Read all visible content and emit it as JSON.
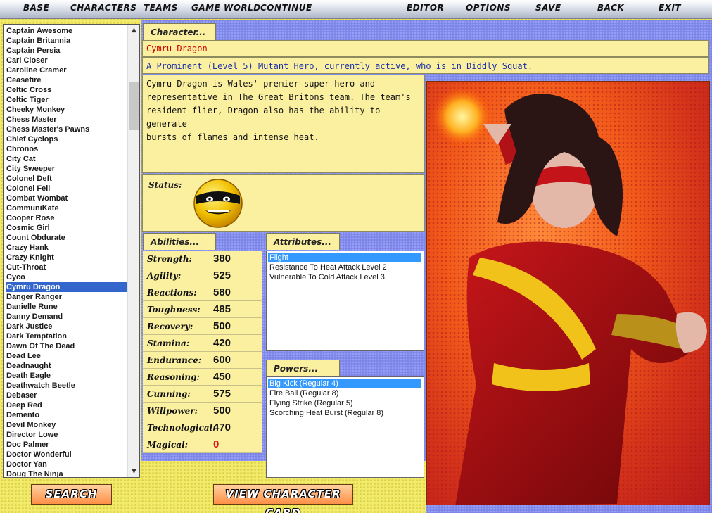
{
  "menu": [
    "BASE",
    "CHARACTERS",
    "TEAMS",
    "GAME WORLD",
    "CONTINUE",
    "EDITOR",
    "OPTIONS",
    "SAVE",
    "BACK",
    "EXIT"
  ],
  "character_list": [
    "Captain Awesome",
    "Captain Britannia",
    "Captain Persia",
    "Carl Closer",
    "Caroline Cramer",
    "Ceasefire",
    "Celtic Cross",
    "Celtic Tiger",
    "Cheeky Monkey",
    "Chess Master",
    "Chess Master's Pawns",
    "Chief Cyclops",
    "Chronos",
    "City Cat",
    "City Sweeper",
    "Colonel Deft",
    "Colonel Fell",
    "Combat Wombat",
    "CommuniKate",
    "Cooper Rose",
    "Cosmic Girl",
    "Count Obdurate",
    "Crazy Hank",
    "Crazy Knight",
    "Cut-Throat",
    "Cyco",
    "Cymru Dragon",
    "Danger Ranger",
    "Danielle Rune",
    "Danny Demand",
    "Dark Justice",
    "Dark Temptation",
    "Dawn Of The Dead",
    "Dead Lee",
    "Deadnaught",
    "Death Eagle",
    "Deathwatch Beetle",
    "Debaser",
    "Deep Red",
    "Demento",
    "Devil Monkey",
    "Director Lowe",
    "Doc Palmer",
    "Doctor Wonderful",
    "Doctor Yan",
    "Doug The Ninja"
  ],
  "selected_character": "Cymru Dragon",
  "character": {
    "tab_label": "Character...",
    "name": "Cymru Dragon",
    "summary": "A Prominent (Level 5) Mutant Hero, currently active, who is in Diddly Squat.",
    "bio_lines": [
      "Cymru Dragon is Wales' premier super hero and",
      "representative in The Great Britons team. The team's",
      "resident flier, Dragon also has the ability to generate",
      "bursts of flames and intense heat."
    ],
    "status_label": "Status:"
  },
  "abilities": {
    "tab_label": "Abilities...",
    "rows": [
      {
        "label": "Strength:",
        "value": "380"
      },
      {
        "label": "Agility:",
        "value": "525"
      },
      {
        "label": "Reactions:",
        "value": "580"
      },
      {
        "label": "Toughness:",
        "value": "485"
      },
      {
        "label": "Recovery:",
        "value": "500"
      },
      {
        "label": "Stamina:",
        "value": "420"
      },
      {
        "label": "Endurance:",
        "value": "600"
      },
      {
        "label": "Reasoning:",
        "value": "450"
      },
      {
        "label": "Cunning:",
        "value": "575"
      },
      {
        "label": "Willpower:",
        "value": "500"
      },
      {
        "label": "Technological:",
        "value": "470"
      },
      {
        "label": "Magical:",
        "value": "0"
      }
    ]
  },
  "attributes": {
    "tab_label": "Attributes...",
    "items": [
      "Flight",
      "Resistance To Heat Attack Level 2",
      "Vulnerable To Cold Attack Level 3"
    ],
    "selected": 0
  },
  "powers": {
    "tab_label": "Powers...",
    "items": [
      "Big Kick (Regular 4)",
      "Fire Ball (Regular 8)",
      "Flying Strike (Regular 5)",
      "Scorching Heat Burst (Regular 8)"
    ],
    "selected": 0
  },
  "buttons": {
    "search": "SEARCH",
    "view_card": "VIEW CHARACTER CARD"
  },
  "colors": {
    "accent_red": "#cc0000",
    "summary_blue": "#1b2fa8",
    "panel": "#fbf0a0",
    "selection": "#3366cc",
    "background_yellow": "#f2ea6a",
    "background_blue": "#7d85e6"
  },
  "icons": {
    "status_icon": "masked-smiley-icon",
    "scroll_up": "chevron-up-icon",
    "scroll_down": "chevron-down-icon"
  }
}
